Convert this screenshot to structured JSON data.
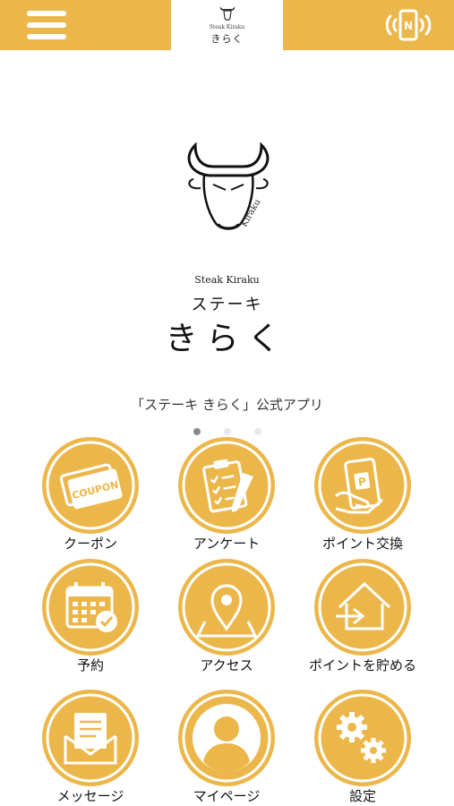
{
  "header": {
    "logo_en": "Steak Kiraku",
    "logo_jp": "きらく"
  },
  "hero": {
    "en_name": "Steak Kiraku",
    "jp_name_line1": "ステーキ",
    "jp_name_line2": "きらく"
  },
  "tagline": "「ステーキ きらく」公式アプリ",
  "carousel": {
    "pages": 3,
    "active": 1
  },
  "menu": [
    {
      "label": "クーポン",
      "icon": "coupon-icon"
    },
    {
      "label": "アンケート",
      "icon": "survey-clipboard-icon"
    },
    {
      "label": "ポイント交換",
      "icon": "point-exchange-icon"
    },
    {
      "label": "予約",
      "icon": "calendar-reservation-icon"
    },
    {
      "label": "アクセス",
      "icon": "map-pin-icon"
    },
    {
      "label": "ポイントを貯める",
      "icon": "point-checkin-icon"
    },
    {
      "label": "メッセージ",
      "icon": "message-envelope-icon"
    },
    {
      "label": "マイページ",
      "icon": "user-profile-icon"
    },
    {
      "label": "設定",
      "icon": "settings-gears-icon"
    }
  ],
  "colors": {
    "accent": "#ecb74a",
    "text": "#111111",
    "dot_active": "#8a8a8a",
    "dot_inactive": "#e8e8e8"
  }
}
